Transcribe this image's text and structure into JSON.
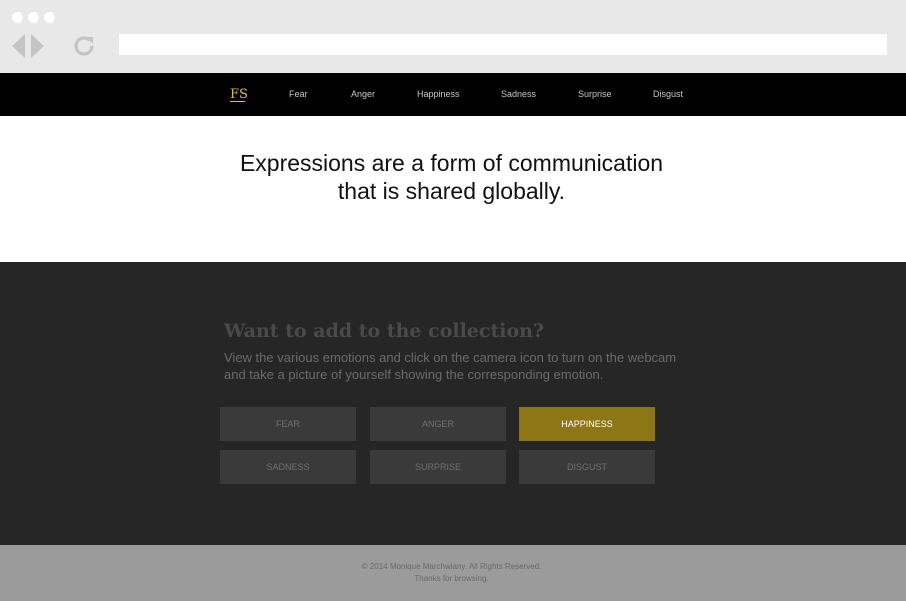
{
  "site": {
    "logo": "FS",
    "nav": [
      "Fear",
      "Anger",
      "Happiness",
      "Sadness",
      "Surprise",
      "Disgust"
    ]
  },
  "hero": {
    "line1": "Expressions are a form of communication",
    "line2": "that is shared globally."
  },
  "collection": {
    "heading": "Want to add to the collection?",
    "description": "View the various emotions and click on the camera icon to turn on the webcam and take a picture of yourself showing the corresponding emotion.",
    "buttons": [
      "FEAR",
      "ANGER",
      "HAPPINESS",
      "SADNESS",
      "SURPRISE",
      "DISGUST"
    ],
    "active": "HAPPINESS"
  },
  "footer": {
    "copyright": "© 2014 Monique Marchwiany. All Rights Reserved.",
    "thanks": "Thanks for browsing."
  },
  "colors": {
    "accent": "#8d7615",
    "logo": "#d8c14a",
    "nav_bg": "#000000",
    "section_bg": "#262626"
  }
}
